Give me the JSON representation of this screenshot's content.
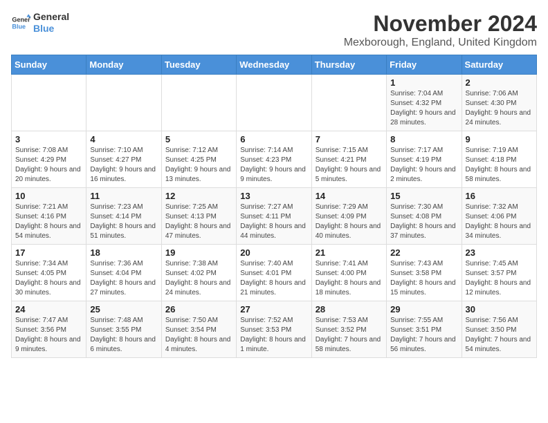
{
  "logo": {
    "line1": "General",
    "line2": "Blue"
  },
  "title": "November 2024",
  "location": "Mexborough, England, United Kingdom",
  "days_of_week": [
    "Sunday",
    "Monday",
    "Tuesday",
    "Wednesday",
    "Thursday",
    "Friday",
    "Saturday"
  ],
  "weeks": [
    [
      {
        "day": "",
        "info": ""
      },
      {
        "day": "",
        "info": ""
      },
      {
        "day": "",
        "info": ""
      },
      {
        "day": "",
        "info": ""
      },
      {
        "day": "",
        "info": ""
      },
      {
        "day": "1",
        "info": "Sunrise: 7:04 AM\nSunset: 4:32 PM\nDaylight: 9 hours and 28 minutes."
      },
      {
        "day": "2",
        "info": "Sunrise: 7:06 AM\nSunset: 4:30 PM\nDaylight: 9 hours and 24 minutes."
      }
    ],
    [
      {
        "day": "3",
        "info": "Sunrise: 7:08 AM\nSunset: 4:29 PM\nDaylight: 9 hours and 20 minutes."
      },
      {
        "day": "4",
        "info": "Sunrise: 7:10 AM\nSunset: 4:27 PM\nDaylight: 9 hours and 16 minutes."
      },
      {
        "day": "5",
        "info": "Sunrise: 7:12 AM\nSunset: 4:25 PM\nDaylight: 9 hours and 13 minutes."
      },
      {
        "day": "6",
        "info": "Sunrise: 7:14 AM\nSunset: 4:23 PM\nDaylight: 9 hours and 9 minutes."
      },
      {
        "day": "7",
        "info": "Sunrise: 7:15 AM\nSunset: 4:21 PM\nDaylight: 9 hours and 5 minutes."
      },
      {
        "day": "8",
        "info": "Sunrise: 7:17 AM\nSunset: 4:19 PM\nDaylight: 9 hours and 2 minutes."
      },
      {
        "day": "9",
        "info": "Sunrise: 7:19 AM\nSunset: 4:18 PM\nDaylight: 8 hours and 58 minutes."
      }
    ],
    [
      {
        "day": "10",
        "info": "Sunrise: 7:21 AM\nSunset: 4:16 PM\nDaylight: 8 hours and 54 minutes."
      },
      {
        "day": "11",
        "info": "Sunrise: 7:23 AM\nSunset: 4:14 PM\nDaylight: 8 hours and 51 minutes."
      },
      {
        "day": "12",
        "info": "Sunrise: 7:25 AM\nSunset: 4:13 PM\nDaylight: 8 hours and 47 minutes."
      },
      {
        "day": "13",
        "info": "Sunrise: 7:27 AM\nSunset: 4:11 PM\nDaylight: 8 hours and 44 minutes."
      },
      {
        "day": "14",
        "info": "Sunrise: 7:29 AM\nSunset: 4:09 PM\nDaylight: 8 hours and 40 minutes."
      },
      {
        "day": "15",
        "info": "Sunrise: 7:30 AM\nSunset: 4:08 PM\nDaylight: 8 hours and 37 minutes."
      },
      {
        "day": "16",
        "info": "Sunrise: 7:32 AM\nSunset: 4:06 PM\nDaylight: 8 hours and 34 minutes."
      }
    ],
    [
      {
        "day": "17",
        "info": "Sunrise: 7:34 AM\nSunset: 4:05 PM\nDaylight: 8 hours and 30 minutes."
      },
      {
        "day": "18",
        "info": "Sunrise: 7:36 AM\nSunset: 4:04 PM\nDaylight: 8 hours and 27 minutes."
      },
      {
        "day": "19",
        "info": "Sunrise: 7:38 AM\nSunset: 4:02 PM\nDaylight: 8 hours and 24 minutes."
      },
      {
        "day": "20",
        "info": "Sunrise: 7:40 AM\nSunset: 4:01 PM\nDaylight: 8 hours and 21 minutes."
      },
      {
        "day": "21",
        "info": "Sunrise: 7:41 AM\nSunset: 4:00 PM\nDaylight: 8 hours and 18 minutes."
      },
      {
        "day": "22",
        "info": "Sunrise: 7:43 AM\nSunset: 3:58 PM\nDaylight: 8 hours and 15 minutes."
      },
      {
        "day": "23",
        "info": "Sunrise: 7:45 AM\nSunset: 3:57 PM\nDaylight: 8 hours and 12 minutes."
      }
    ],
    [
      {
        "day": "24",
        "info": "Sunrise: 7:47 AM\nSunset: 3:56 PM\nDaylight: 8 hours and 9 minutes."
      },
      {
        "day": "25",
        "info": "Sunrise: 7:48 AM\nSunset: 3:55 PM\nDaylight: 8 hours and 6 minutes."
      },
      {
        "day": "26",
        "info": "Sunrise: 7:50 AM\nSunset: 3:54 PM\nDaylight: 8 hours and 4 minutes."
      },
      {
        "day": "27",
        "info": "Sunrise: 7:52 AM\nSunset: 3:53 PM\nDaylight: 8 hours and 1 minute."
      },
      {
        "day": "28",
        "info": "Sunrise: 7:53 AM\nSunset: 3:52 PM\nDaylight: 7 hours and 58 minutes."
      },
      {
        "day": "29",
        "info": "Sunrise: 7:55 AM\nSunset: 3:51 PM\nDaylight: 7 hours and 56 minutes."
      },
      {
        "day": "30",
        "info": "Sunrise: 7:56 AM\nSunset: 3:50 PM\nDaylight: 7 hours and 54 minutes."
      }
    ]
  ]
}
